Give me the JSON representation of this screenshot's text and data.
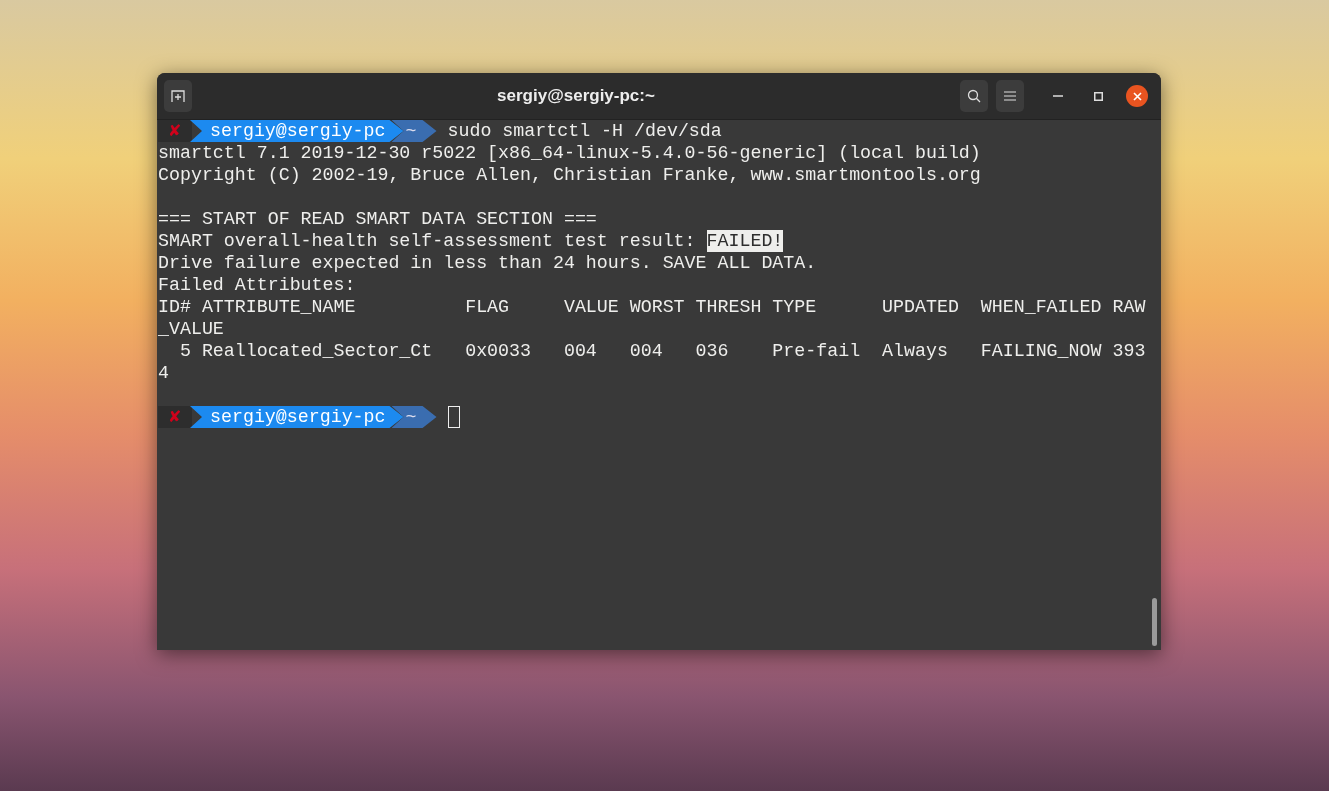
{
  "window": {
    "title": "sergiy@sergiy-pc:~"
  },
  "terminal": {
    "lines": [
      {
        "kind": "prompt",
        "status": "✘",
        "user": "sergiy@sergiy-pc",
        "dir": "~",
        "command": "sudo smartctl -H /dev/sda",
        "cursor": false
      },
      {
        "kind": "output",
        "text": "smartctl 7.1 2019-12-30 r5022 [x86_64-linux-5.4.0-56-generic] (local build)"
      },
      {
        "kind": "output",
        "text": "Copyright (C) 2002-19, Bruce Allen, Christian Franke, www.smartmontools.org"
      },
      {
        "kind": "blank"
      },
      {
        "kind": "output",
        "text": "=== START OF READ SMART DATA SECTION ==="
      },
      {
        "kind": "highlighted",
        "text": "SMART overall-health self-assessment test result: ",
        "highlight": "FAILED!"
      },
      {
        "kind": "output",
        "text": "Drive failure expected in less than 24 hours. SAVE ALL DATA."
      },
      {
        "kind": "output",
        "text": "Failed Attributes:"
      },
      {
        "kind": "output",
        "text": "ID# ATTRIBUTE_NAME          FLAG     VALUE WORST THRESH TYPE      UPDATED  WHEN_FAILED RAW"
      },
      {
        "kind": "output",
        "text": "_VALUE"
      },
      {
        "kind": "output",
        "text": "  5 Reallocated_Sector_Ct   0x0033   004   004   036    Pre-fail  Always   FAILING_NOW 393"
      },
      {
        "kind": "output",
        "text": "4"
      },
      {
        "kind": "blank"
      },
      {
        "kind": "prompt",
        "status": "✘",
        "user": "sergiy@sergiy-pc",
        "dir": "~",
        "cursor": true
      }
    ]
  }
}
